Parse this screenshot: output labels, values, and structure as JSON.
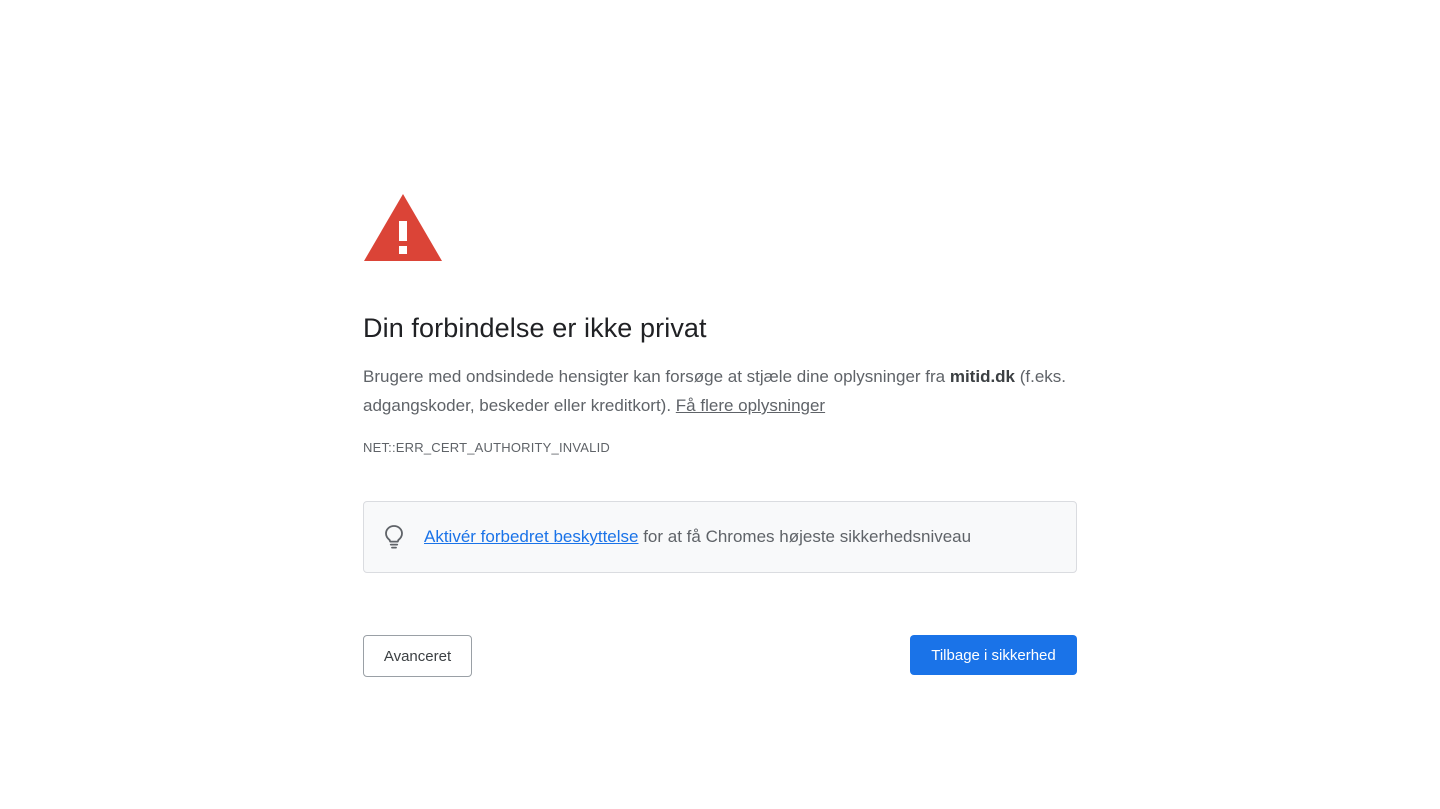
{
  "interstitial": {
    "title": "Din forbindelse er ikke privat",
    "body_prefix": "Brugere med ondsindede hensigter kan forsøge at stjæle dine oplysninger fra ",
    "domain": "mitid.dk",
    "body_suffix": " (f.eks. adgangskoder, beskeder eller kreditkort). ",
    "learn_more_link": "Få flere oplysninger",
    "error_code": "NET::ERR_CERT_AUTHORITY_INVALID"
  },
  "enhanced_protection": {
    "icon": "lightbulb-icon",
    "link_text": "Aktivér forbedret beskyttelse",
    "suffix_text": " for at få Chromes højeste sikkerhedsniveau"
  },
  "buttons": {
    "advanced_label": "Avanceret",
    "back_label": "Tilbage i sikkerhed"
  },
  "colors": {
    "warning_red": "#db4437",
    "primary_blue": "#1a73e8",
    "link_blue": "#1a73e8",
    "text_secondary": "#5f6368",
    "box_background": "#f8f9fa"
  },
  "icons": {
    "warning": "warning-triangle-icon"
  }
}
